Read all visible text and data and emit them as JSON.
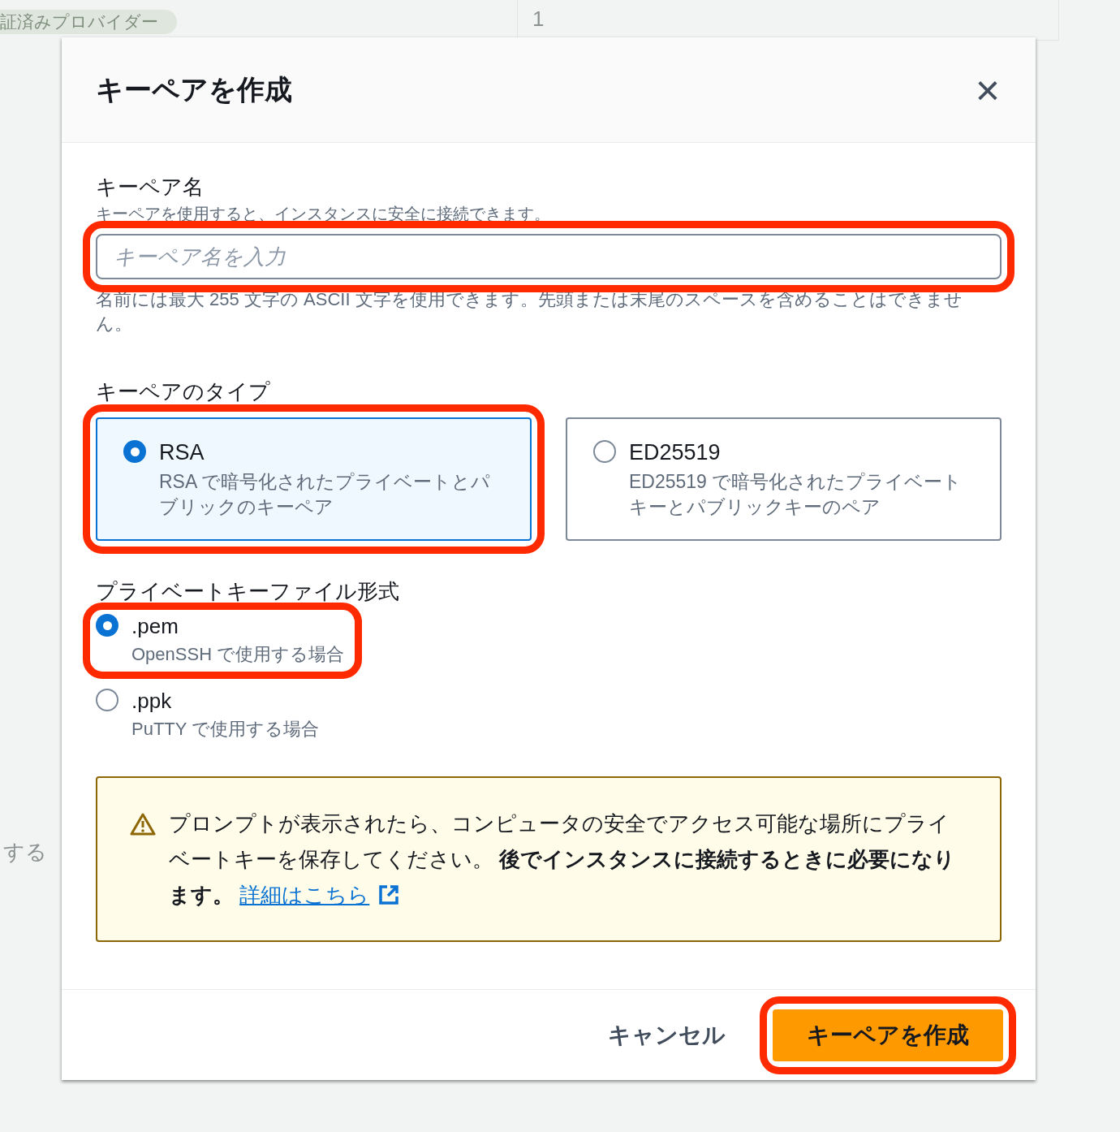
{
  "background": {
    "tag": "証済みプロバイダー",
    "field_value": "1",
    "side_text": "する"
  },
  "dialog": {
    "title": "キーペアを作成",
    "close": "×",
    "name_field": {
      "label": "キーペア名",
      "description": "キーペアを使用すると、インスタンスに安全に接続できます。",
      "placeholder": "キーペア名を入力",
      "hint": "名前には最大 255 文字の ASCII 文字を使用できます。先頭または末尾のスペースを含めることはできません。",
      "highlighted": true
    },
    "key_type": {
      "label": "キーペアのタイプ",
      "options": [
        {
          "title": "RSA",
          "description": "RSA で暗号化されたプライベートとパブリックのキーペア",
          "selected": true,
          "highlighted": true
        },
        {
          "title": "ED25519",
          "description": "ED25519 で暗号化されたプライベートキーとパブリックキーのペア",
          "selected": false,
          "highlighted": false
        }
      ]
    },
    "file_format": {
      "label": "プライベートキーファイル形式",
      "options": [
        {
          "title": ".pem",
          "description": "OpenSSH で使用する場合",
          "selected": true,
          "highlighted": true
        },
        {
          "title": ".ppk",
          "description": "PuTTY で使用する場合",
          "selected": false,
          "highlighted": false
        }
      ]
    },
    "warning": {
      "text": "プロンプトが表示されたら、コンピュータの安全でアクセス可能な場所にプライベートキーを保存してください。 **後でインスタンスに接続するときに必要になります。**",
      "link": "詳細はこちら"
    },
    "buttons": [
      {
        "label": "キャンセル",
        "kind": "secondary",
        "highlighted": false
      },
      {
        "label": "キーペアを作成",
        "kind": "primary",
        "highlighted": true
      }
    ]
  }
}
